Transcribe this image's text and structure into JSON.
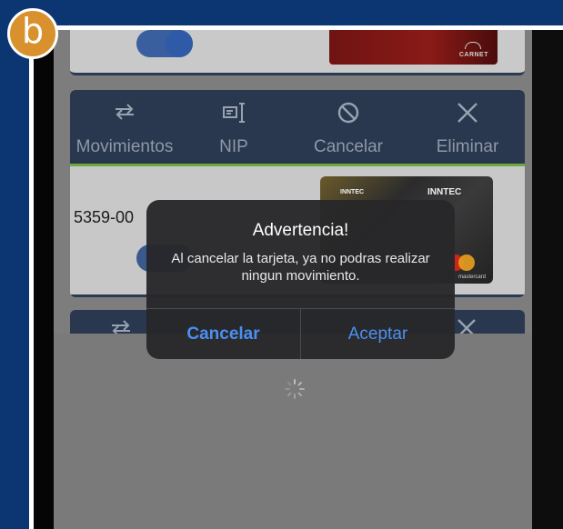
{
  "badge": {
    "letter": "b"
  },
  "top_card": {
    "brand": "CARNET"
  },
  "actions": [
    {
      "icon": "swap-arrows-icon",
      "label": "Movimientos"
    },
    {
      "icon": "nip-icon",
      "label": "NIP"
    },
    {
      "icon": "block-icon",
      "label": "Cancelar"
    },
    {
      "icon": "close-icon",
      "label": "Eliminar"
    }
  ],
  "card": {
    "number_partial": "5359-00",
    "brand_small": "INNTEC",
    "brand_large": "INNTEC",
    "network_text": "mastercard"
  },
  "alert": {
    "title": "Advertencia!",
    "message": "Al cancelar la tarjeta, ya no podras realizar ningun movimiento.",
    "cancel_label": "Cancelar",
    "ok_label": "Aceptar"
  },
  "colors": {
    "frame_blue": "#0b3672",
    "badge_orange": "#d8912c",
    "action_bar": "#29384e",
    "accent_green": "#6fa83c",
    "alert_button": "#4c8ff2"
  }
}
